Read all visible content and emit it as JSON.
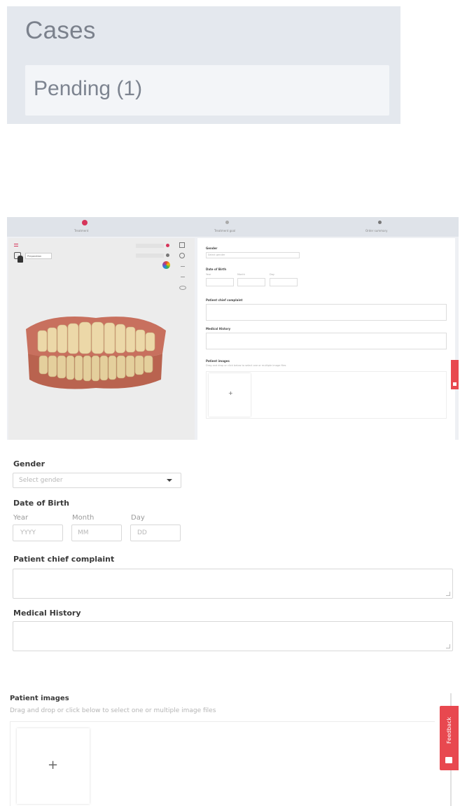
{
  "cases": {
    "title": "Cases",
    "pending_label": "Pending (1)"
  },
  "app": {
    "step1": "Treatment",
    "step2": "Treatment goal",
    "step3": "Order summary",
    "tooltip": "Preparation",
    "mini_gender": "Gender",
    "mini_gender_placeholder": "Select gender",
    "mini_dob": "Date of Birth",
    "mini_year": "Year",
    "mini_month": "Month",
    "mini_day": "Day",
    "mini_complaint": "Patient chief complaint",
    "mini_history": "Medical History",
    "mini_images": "Patient images",
    "mini_images_hint": "Drag and drop or click below to select one or multiple image files",
    "mini_add": "+",
    "feedback": "Feedback",
    "accent": "#e0355a"
  },
  "form": {
    "gender_label": "Gender",
    "gender_placeholder": "Select gender",
    "dob_label": "Date of Birth",
    "year_label": "Year",
    "month_label": "Month",
    "day_label": "Day",
    "year_placeholder": "YYYY",
    "month_placeholder": "MM",
    "day_placeholder": "DD",
    "complaint_label": "Patient chief complaint",
    "history_label": "Medical History"
  },
  "images": {
    "label": "Patient images",
    "hint": "Drag and drop or click below to select one or multiple image files",
    "add": "+",
    "feedback": "Feedback"
  }
}
